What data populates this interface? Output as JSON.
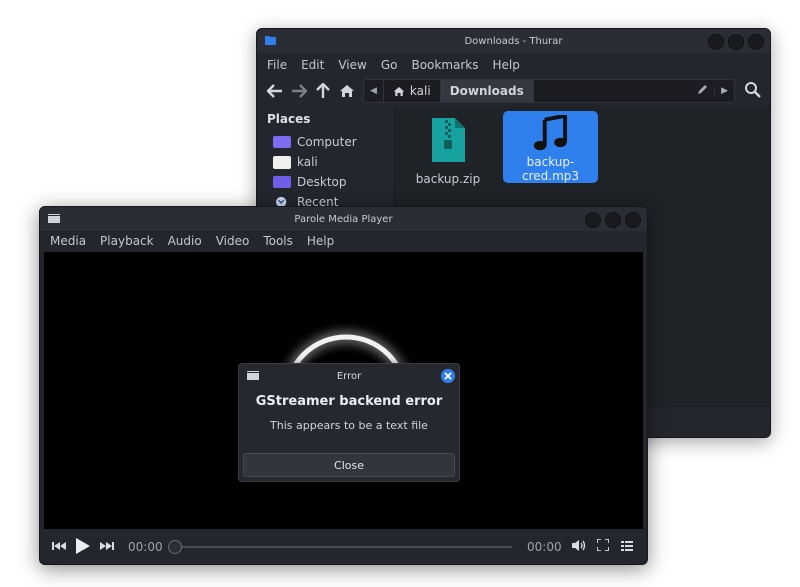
{
  "thunar": {
    "title": "Downloads - Thurar",
    "menu": [
      "File",
      "Edit",
      "View",
      "Go",
      "Bookmarks",
      "Help"
    ],
    "breadcrumbs": [
      "kali",
      "Downloads"
    ],
    "sidebar": {
      "section": "Places",
      "items": [
        {
          "label": "Computer",
          "icon": "computer-icon",
          "color": "#7b6cf0"
        },
        {
          "label": "kali",
          "icon": "home-folder-icon",
          "color": "#f0f0f0"
        },
        {
          "label": "Desktop",
          "icon": "desktop-icon",
          "color": "#6f5fe8"
        },
        {
          "label": "Recent",
          "icon": "recent-icon",
          "color": "#c8d8f0"
        }
      ]
    },
    "files": [
      {
        "name": "backup.zip",
        "icon": "zip-file-icon",
        "color": "#17a2a0",
        "selected": false
      },
      {
        "name": "backup-cred.mp3",
        "icon": "audio-file-icon",
        "color": "#111111",
        "selected": true
      }
    ]
  },
  "parole": {
    "title": "Parole Media Player",
    "menu": [
      "Media",
      "Playback",
      "Audio",
      "Video",
      "Tools",
      "Help"
    ],
    "time_current": "00:00",
    "time_total": "00:00"
  },
  "dialog": {
    "title": "Error",
    "heading": "GStreamer backend error",
    "message": "This appears to be a text file",
    "button": "Close"
  },
  "colors": {
    "accent": "#2f80ed",
    "window_bg": "#23262d"
  }
}
